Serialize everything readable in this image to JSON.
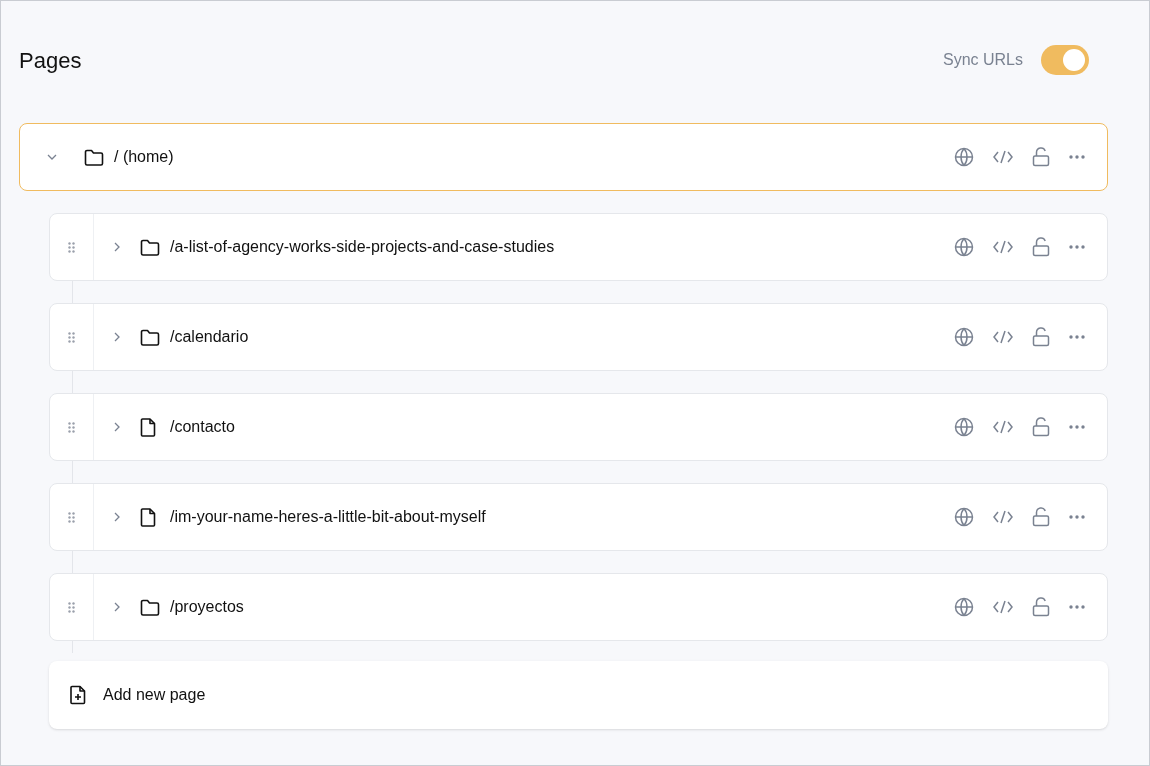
{
  "title": "Pages",
  "sync": {
    "label": "Sync URLs",
    "on": true
  },
  "root": {
    "path": "/ (home)",
    "kind": "folder",
    "expanded": true,
    "selected": true,
    "children": [
      {
        "path": "/a-list-of-agency-works-side-projects-and-case-studies",
        "kind": "folder",
        "expanded": false,
        "selected": false
      },
      {
        "path": "/calendario",
        "kind": "folder",
        "expanded": false,
        "selected": false
      },
      {
        "path": "/contacto",
        "kind": "file",
        "expanded": false,
        "selected": false
      },
      {
        "path": "/im-your-name-heres-a-little-bit-about-myself",
        "kind": "file",
        "expanded": false,
        "selected": false
      },
      {
        "path": "/proyectos",
        "kind": "folder",
        "expanded": false,
        "selected": false
      }
    ]
  },
  "add_button": "Add new page"
}
